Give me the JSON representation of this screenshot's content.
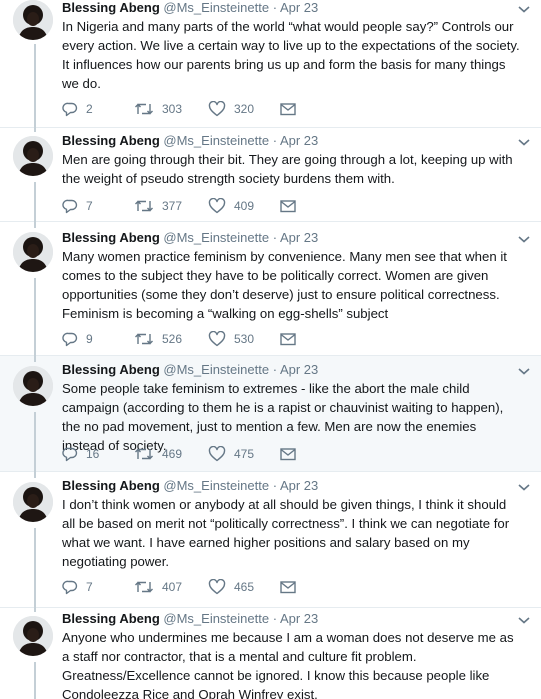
{
  "author": {
    "name": "Blessing Abeng",
    "handle": "@Ms_Einsteinette",
    "separator": "·"
  },
  "colors": {
    "text": "#14171a",
    "muted": "#657786",
    "thread_line": "#c4cfd6",
    "highlight_bg": "#f5f8fa"
  },
  "icons": {
    "reply": "reply-icon",
    "retweet": "retweet-icon",
    "like": "heart-icon",
    "dm": "envelope-icon",
    "menu": "chevron-down-icon",
    "avatar": "avatar"
  },
  "tweets": [
    {
      "date": "Apr 23",
      "text": "In Nigeria and many parts of the world “what would people say?” Controls our every action. We live a certain way to live up to the expectations of the society. It influences how our parents bring us up and form the basis for many things we do.",
      "replies": "2",
      "retweets": "303",
      "likes": "320"
    },
    {
      "date": "Apr 23",
      "text": "Men are going through their bit. They are going through a lot, keeping up with the weight of pseudo strength society burdens them with.",
      "replies": "7",
      "retweets": "377",
      "likes": "409"
    },
    {
      "date": "Apr 23",
      "text": "Many women practice feminism by convenience. Many men see that when it comes to the subject they have to be politically correct. Women are given opportunities (some they don’t deserve) just to ensure political correctness. Feminism is becoming a “walking on egg-shells” subject",
      "replies": "9",
      "retweets": "526",
      "likes": "530"
    },
    {
      "date": "Apr 23",
      "text": "Some people take feminism to extremes - like the abort the male child campaign (according to them he is a rapist or chauvinist waiting to happen), the no pad movement, just to mention a few. Men are now the enemies instead of society.",
      "replies": "16",
      "retweets": "469",
      "likes": "475"
    },
    {
      "date": "Apr 23",
      "text": "I don’t think women or anybody at all should be given things, I think it should all be based on merit not “politically correctness”. I think we can negotiate for what we want. I have earned higher positions and salary based on my negotiating power.",
      "replies": "7",
      "retweets": "407",
      "likes": "465"
    },
    {
      "date": "Apr 23",
      "text": "Anyone who undermines me because I am a woman does not deserve me as a staff nor contractor, that is a mental and culture fit problem. Greatness/Excellence cannot be ignored. I know this because people like Condoleezza Rice and Oprah Winfrey exist.",
      "replies": "",
      "retweets": "",
      "likes": ""
    }
  ]
}
